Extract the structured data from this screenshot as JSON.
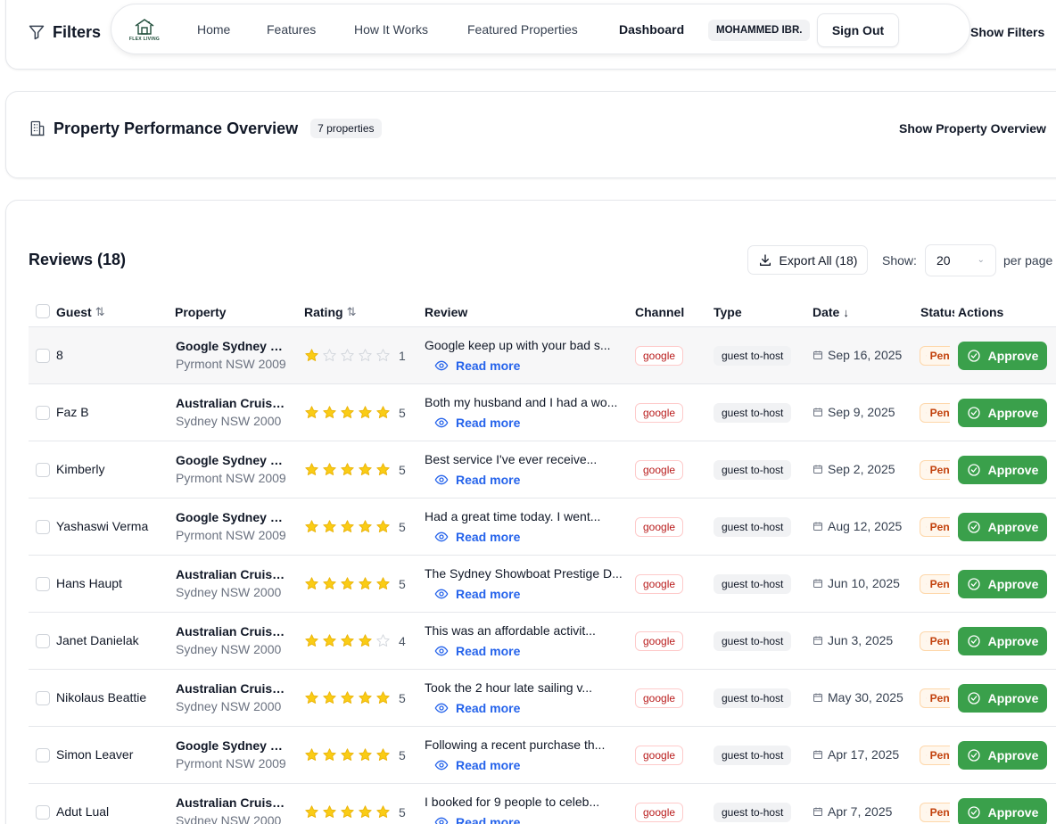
{
  "filters": {
    "title": "Filters",
    "toggle_label": "Show Filters"
  },
  "nav": {
    "logo_text": "FLEX LIVING",
    "links": [
      "Home",
      "Features",
      "How It Works",
      "Featured Properties",
      "Dashboard"
    ],
    "active": "Dashboard",
    "user": "MOHAMMED IBR.",
    "sign_out": "Sign Out"
  },
  "overview": {
    "title": "Property Performance Overview",
    "count": "7 properties",
    "toggle_label": "Show Property Overview"
  },
  "reviews": {
    "title": "Reviews (18)",
    "export_label": "Export All (18)",
    "show_label": "Show:",
    "per_page_value": "20",
    "per_page_label": "per page",
    "columns": {
      "guest": "Guest",
      "property": "Property",
      "rating": "Rating",
      "review": "Review",
      "channel": "Channel",
      "type": "Type",
      "date": "Date",
      "status": "Status",
      "actions": "Actions"
    },
    "read_more": "Read more",
    "approve": "Approve",
    "status_label": "Pending",
    "rows": [
      {
        "guest": "8",
        "property": "Google Sydney - ...",
        "location": "Pyrmont NSW 2009",
        "rating": 1,
        "rating_text": "1",
        "review": "Google keep up with your bad s...",
        "channel": "google",
        "type": "guest to-host",
        "date": "Sep 16, 2025"
      },
      {
        "guest": "Faz B",
        "property": "Australian Cruise ...",
        "location": "Sydney NSW 2000",
        "rating": 5,
        "rating_text": "5",
        "review": "Both my husband and I had a wo...",
        "channel": "google",
        "type": "guest to-host",
        "date": "Sep 9, 2025"
      },
      {
        "guest": "Kimberly",
        "property": "Google Sydney - ...",
        "location": "Pyrmont NSW 2009",
        "rating": 5,
        "rating_text": "5",
        "review": "Best service I've ever receive...",
        "channel": "google",
        "type": "guest to-host",
        "date": "Sep 2, 2025"
      },
      {
        "guest": "Yashaswi Verma",
        "property": "Google Sydney - ...",
        "location": "Pyrmont NSW 2009",
        "rating": 5,
        "rating_text": "5",
        "review": "Had a great time today. I went...",
        "channel": "google",
        "type": "guest to-host",
        "date": "Aug 12, 2025"
      },
      {
        "guest": "Hans Haupt",
        "property": "Australian Cruise ...",
        "location": "Sydney NSW 2000",
        "rating": 5,
        "rating_text": "5",
        "review": "The Sydney Showboat Prestige D...",
        "channel": "google",
        "type": "guest to-host",
        "date": "Jun 10, 2025"
      },
      {
        "guest": "Janet Danielak",
        "property": "Australian Cruise ...",
        "location": "Sydney NSW 2000",
        "rating": 4,
        "rating_text": "4",
        "review": "This was an affordable activit...",
        "channel": "google",
        "type": "guest to-host",
        "date": "Jun 3, 2025"
      },
      {
        "guest": "Nikolaus Beattie",
        "property": "Australian Cruise ...",
        "location": "Sydney NSW 2000",
        "rating": 5,
        "rating_text": "5",
        "review": "Took the 2 hour late sailing v...",
        "channel": "google",
        "type": "guest to-host",
        "date": "May 30, 2025"
      },
      {
        "guest": "Simon Leaver",
        "property": "Google Sydney - ...",
        "location": "Pyrmont NSW 2009",
        "rating": 5,
        "rating_text": "5",
        "review": "Following a recent purchase th...",
        "channel": "google",
        "type": "guest to-host",
        "date": "Apr 17, 2025"
      },
      {
        "guest": "Adut Lual",
        "property": "Australian Cruise ...",
        "location": "Sydney NSW 2000",
        "rating": 5,
        "rating_text": "5",
        "review": "I booked for 9 people to celeb...",
        "channel": "google",
        "type": "guest to-host",
        "date": "Apr 7, 2025"
      }
    ]
  },
  "colors": {
    "approve": "#3aa04b",
    "star_filled": "#facc15",
    "star_empty": "#d1d5db",
    "link": "#2563eb",
    "channel": "#b91c1c",
    "status": "#c2410c"
  }
}
